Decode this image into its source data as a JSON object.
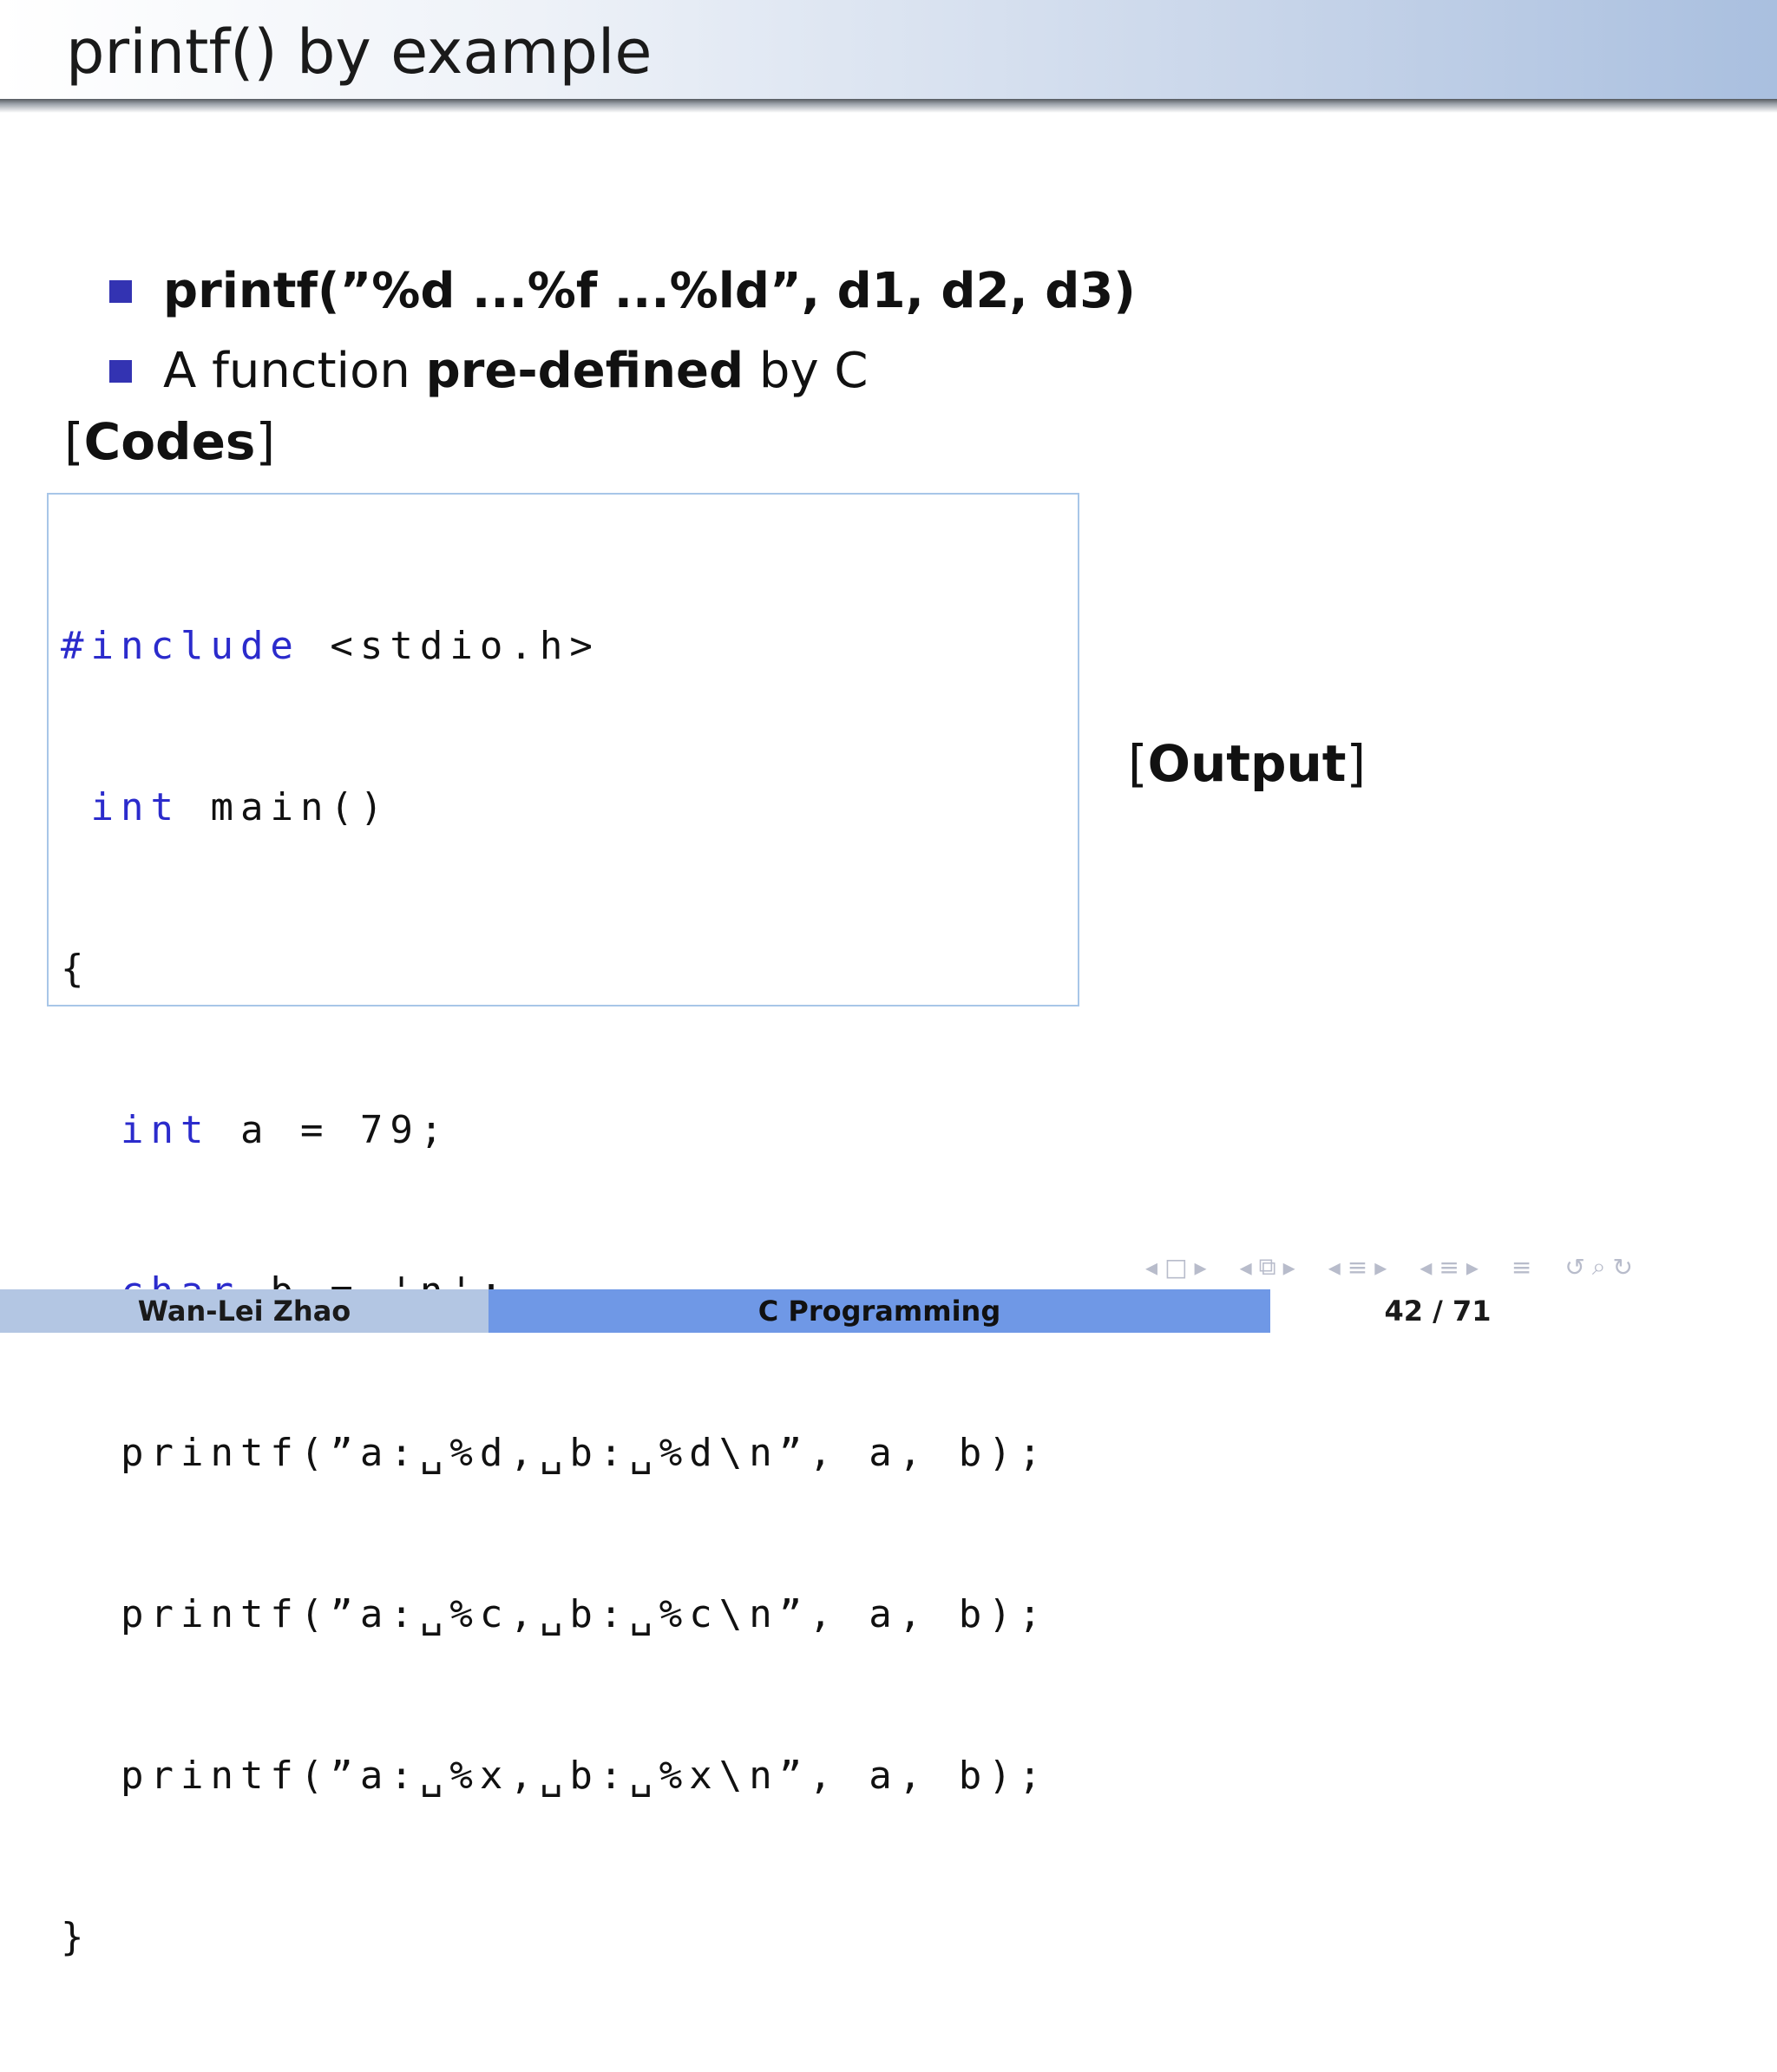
{
  "slide": {
    "title": "printf() by example"
  },
  "bullets": [
    {
      "text": "printf(”%d ...%f ...%ld”, d1, d2, d3)"
    },
    {
      "pre": "A function ",
      "bold": "pre-defined",
      "post": " by C"
    }
  ],
  "labels": {
    "codes": "Codes",
    "output": "Output",
    "open_bracket": "[",
    "close_bracket": "]"
  },
  "code": {
    "include_kw": "#include",
    "include_rest": " <stdio.h>",
    "int_kw": "int",
    "main_rest": " main()",
    "open_brace": "{",
    "decl_a_kw": "int",
    "decl_a_rest": " a = 79;",
    "decl_b_kw": "char",
    "decl_b_rest": " b = 'n';",
    "printf_d": "printf(”a:␣%d,␣b:␣%d\\n”, a, b);",
    "printf_c": "printf(”a:␣%c,␣b:␣%c\\n”, a, b);",
    "printf_x": "printf(”a:␣%x,␣b:␣%x\\n”, a, b);",
    "close_brace": "}"
  },
  "nav": {
    "prev_frame": "◂",
    "frame_icon": "□",
    "next_frame": "▸",
    "prev_sub": "◂",
    "sub_icon": "⧉",
    "next_sub": "▸",
    "prev_section": "◂",
    "section_icon": "≡",
    "next_section": "▸",
    "prev_subsection": "◂",
    "subsection_icon": "≡",
    "next_subsection": "▸",
    "toc_icon": "≡",
    "loop_icon": "↺",
    "zoom_icon": "⌕",
    "back_icon": "↻"
  },
  "footer": {
    "author": "Wan-Lei Zhao",
    "course": "C Programming",
    "page_current": "42",
    "page_sep": " / ",
    "page_total": "71"
  },
  "colors": {
    "bullet": "#3333b2",
    "keyword": "#2b2bcc",
    "footer_left": "#b3c6e3",
    "footer_mid": "#6f98e6",
    "code_border": "#a8c6e8"
  }
}
